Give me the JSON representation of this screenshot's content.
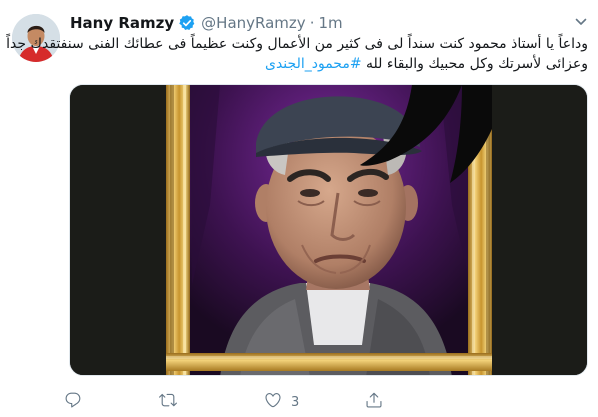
{
  "tweet": {
    "author_name": "Hany Ramzy",
    "handle": "@HanyRamzy",
    "separator": "·",
    "time": "1m",
    "text_lines": [
      "وداعاً يا أستاذ محمود كنت سنداً لى فى كثير من الأعمال وكنت عظيماً فى عطائك الفنى سنفتقدك جداً",
      "وعزائى لأسرتك وكل محبيك والبقاء لله"
    ],
    "hashtag": "#محمود_الجندى"
  },
  "actions": {
    "reply_count": "",
    "retweet_count": "",
    "like_count": "3",
    "share_count": ""
  },
  "colors": {
    "accent": "#1da1f2",
    "secondary_text": "#657786",
    "frame_gold": "#e0b24a",
    "backdrop_purple": "#5a1a78"
  }
}
